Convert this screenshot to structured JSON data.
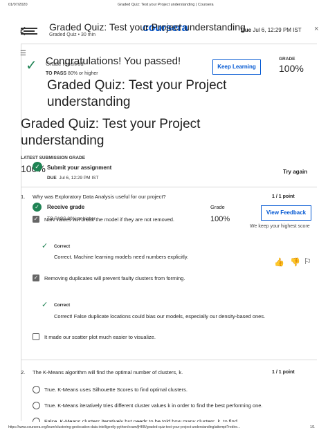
{
  "print_header": {
    "date": "01/07/2020",
    "doc_title": "Graded Quiz: Test your Project understanding | Coursera"
  },
  "print_footer": {
    "url": "https://www.coursera.org/learn/clustering-geolocation-data-intelligently-python/exam/jHKB/graded-quiz-test-your-project-understanding/attempt?redire...",
    "page": "1/1"
  },
  "header": {
    "title": "Graded Quiz: Test your Project understanding",
    "subtitle": "Graded Quiz • 30 min",
    "logo": "coursera",
    "due_label": "Due",
    "due_value": "Jul 6, 12:29 PM IST",
    "close_icon": "×"
  },
  "banner": {
    "ghost_text": "Grade received",
    "message": "Congratulations! You passed!",
    "to_pass_label": "TO PASS",
    "to_pass_value": "80% or higher",
    "keep_learning": "Keep Learning",
    "grade_label": "GRADE",
    "grade_value": "100%"
  },
  "quiz_title": "Graded Quiz: Test your Project understanding",
  "latest": {
    "label": "LATEST SUBMISSION GRADE",
    "value": "100%",
    "submit_label": "Submit your assignment",
    "due_label": "DUE",
    "due_value": "Jul 6, 12:29 PM IST",
    "try_again": "Try again"
  },
  "receive": {
    "label": "Receive grade",
    "to_pass": "TO PASS 80% or higher",
    "grade_label": "Grade",
    "grade_value": "100%",
    "view_feedback": "View Feedback",
    "note": "We keep your highest score"
  },
  "questions": [
    {
      "num": "1.",
      "text": "Why was Exploratory Data Analysis useful for our project?",
      "points": "1 / 1 point",
      "options": [
        {
          "text": "NaN values will break the model if they are not removed.",
          "checked": true,
          "feedback_title": "Correct",
          "feedback": "Correct. Machine learning models need numbers explicitly."
        },
        {
          "text": "Removing duplicates will prevent faulty clusters from forming.",
          "checked": true,
          "feedback_title": "Correct",
          "feedback": "Correct! False duplicate locations could bias our models, especially our density-based ones."
        },
        {
          "text": "It made our scatter plot much easier to visualize.",
          "checked": false
        }
      ]
    },
    {
      "num": "2.",
      "text": "The K-Means algorithm will find the optimal number of clusters, k.",
      "points": "1 / 1 point",
      "options": [
        {
          "text": "True. K-Means uses Silhouette Scores to find optimal clusters."
        },
        {
          "text": "True. K-Means iteratively tries different cluster values k in order to find the best performing one."
        },
        {
          "text": "False. K-Means clusters iteratively but needs to be told how many clusters, k, to find."
        }
      ]
    }
  ]
}
